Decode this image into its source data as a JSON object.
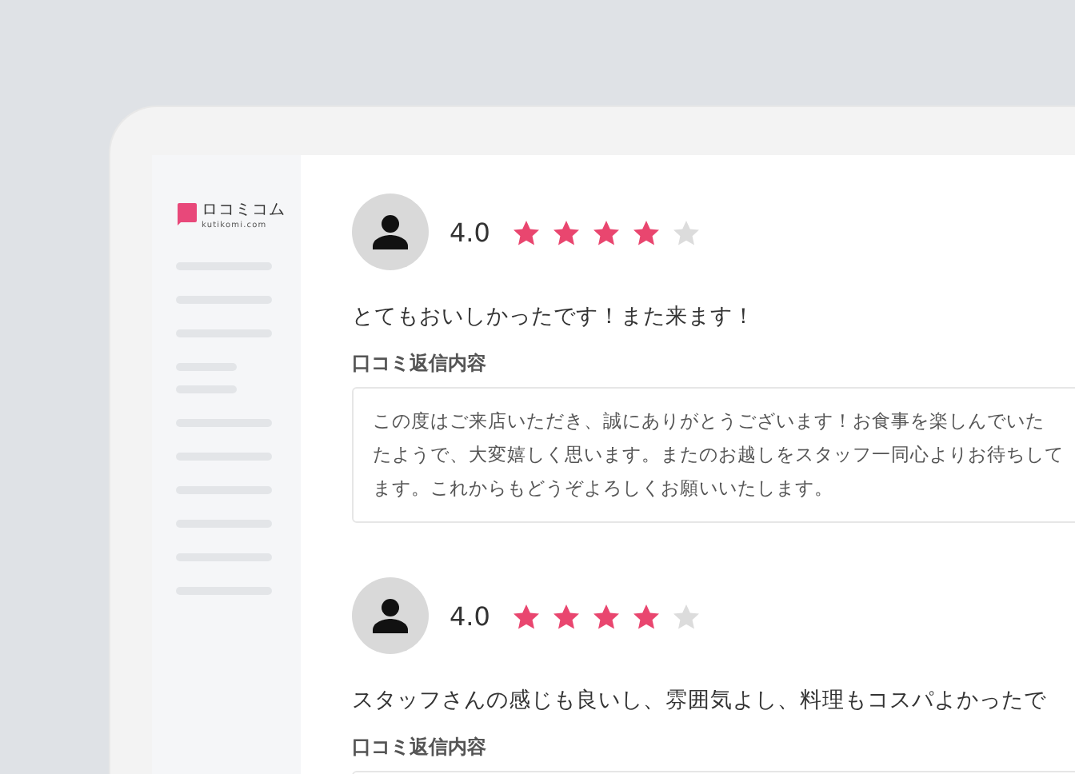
{
  "brand": {
    "name": "ロコミコム",
    "domain": "kutikomi.com"
  },
  "sidebar": {
    "placeholder_lines": [
      {
        "kind": "long"
      },
      {
        "kind": "long"
      },
      {
        "kind": "long"
      },
      {
        "kind": "short"
      },
      {
        "kind": "short"
      },
      {
        "kind": "long"
      },
      {
        "kind": "long"
      },
      {
        "kind": "long"
      },
      {
        "kind": "long"
      },
      {
        "kind": "long"
      },
      {
        "kind": "long"
      }
    ]
  },
  "reviews": [
    {
      "rating": "4.0",
      "stars": 4,
      "comment": "とてもおいしかったです！また来ます！",
      "reply_label": "口コミ返信内容",
      "reply_lines": [
        "この度はご来店いただき、誠にありがとうございます！お食事を楽しんでいた",
        "たようで、大変嬉しく思います。またのお越しをスタッフ一同心よりお待ちして",
        "ます。これからもどうぞよろしくお願いいたします。"
      ]
    },
    {
      "rating": "4.0",
      "stars": 4,
      "comment": "スタッフさんの感じも良いし、雰囲気よし、料理もコスパよかったで",
      "reply_label": "口コミ返信内容"
    }
  ]
}
